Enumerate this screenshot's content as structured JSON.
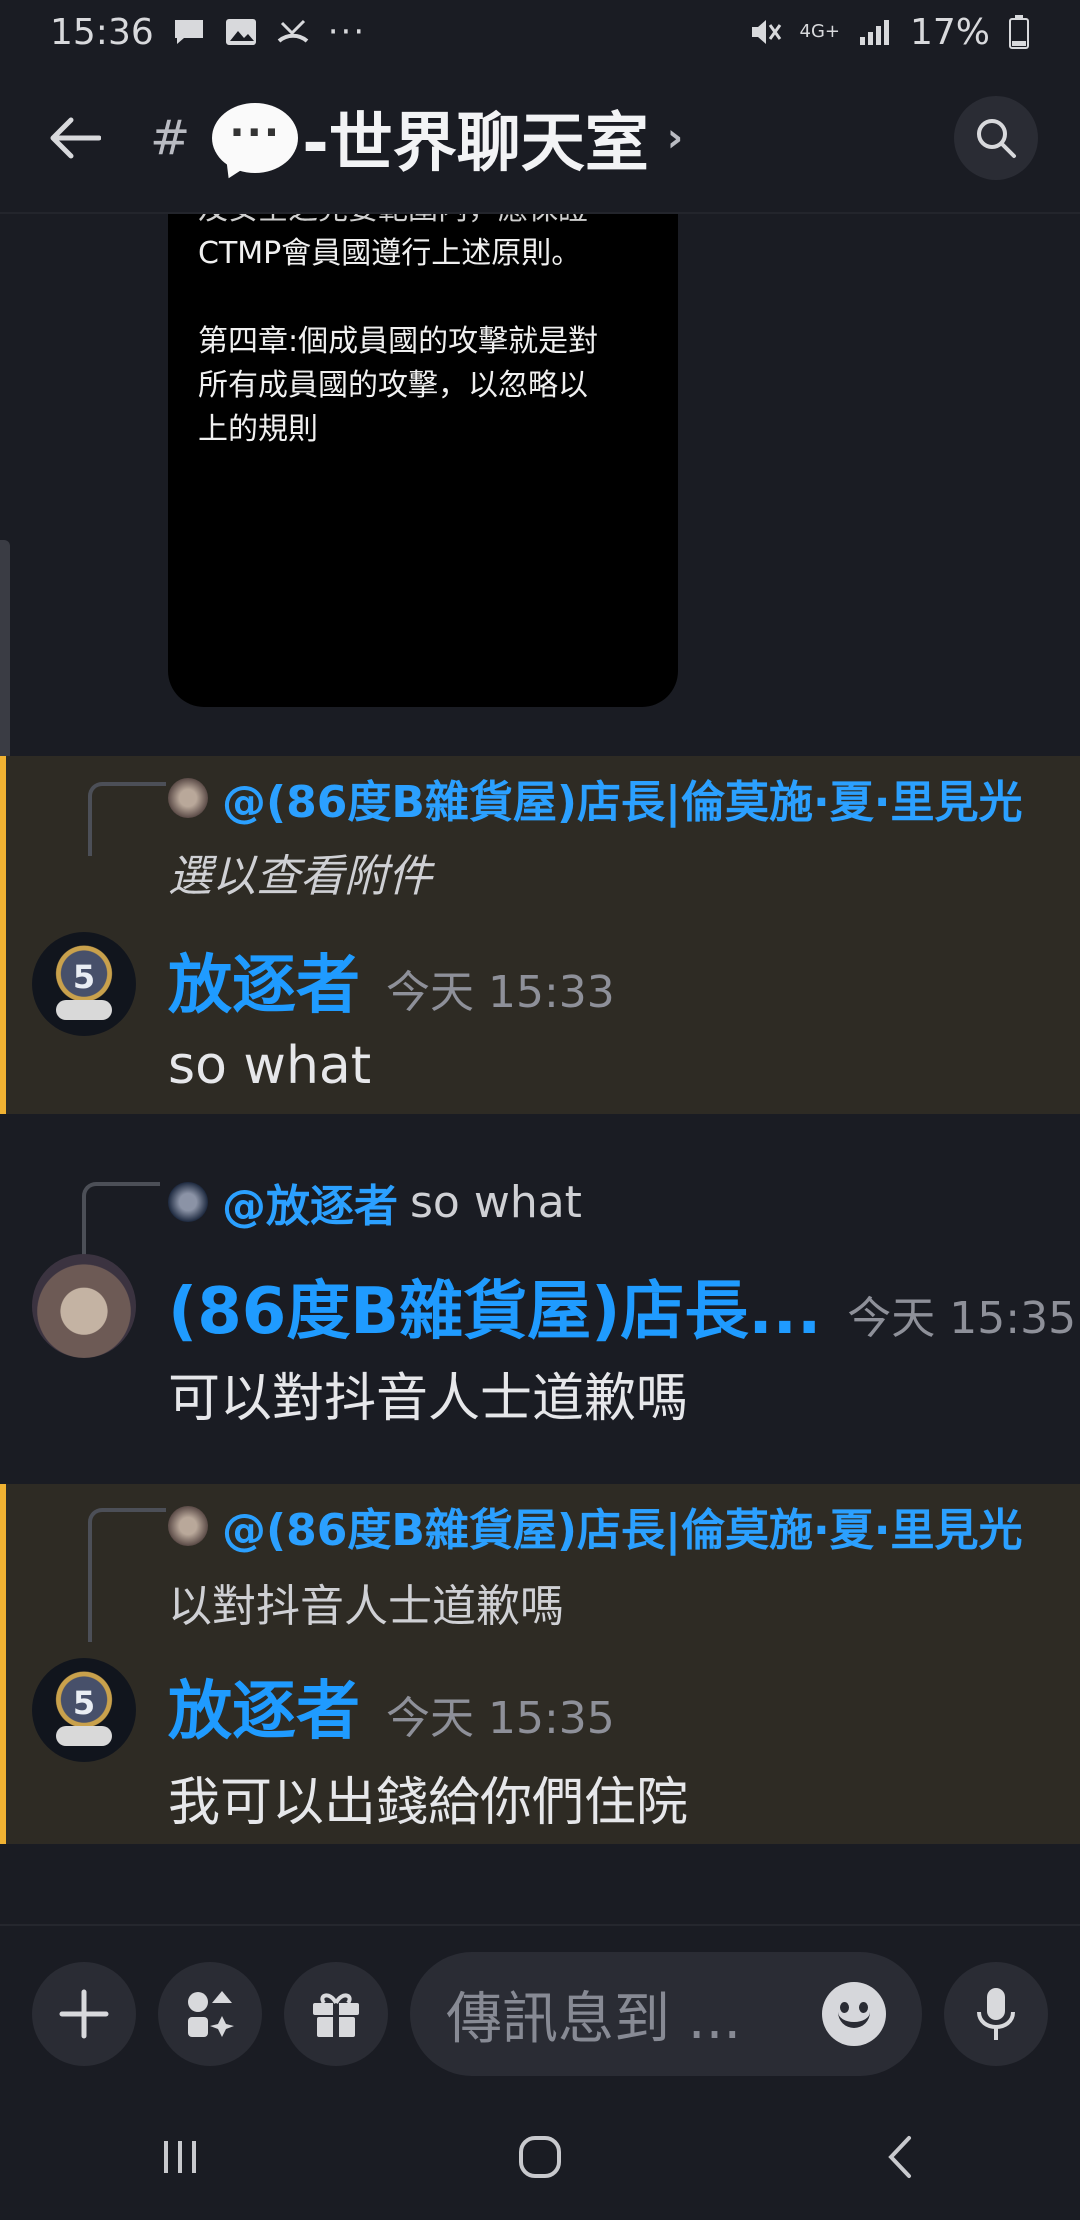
{
  "status_bar": {
    "time": "15:36",
    "network": "4G+",
    "battery": "17%",
    "icons_left": [
      "chat-bubble-icon",
      "image-icon",
      "missed-call-icon",
      "more-dots-icon"
    ],
    "icons_right": [
      "mute-icon",
      "network-icon",
      "signal-icon",
      "battery-icon"
    ]
  },
  "header": {
    "channel_prefix": "#",
    "channel_emoji": "···",
    "channel_name": "-世界聊天室",
    "chevron": "›"
  },
  "image_attachment": {
    "partial_top": "及安全之宪要範圍内，應保證",
    "line1": "CTMP會員國遵行上述原則。",
    "line2": "第四章:個成員國的攻擊就是對\n所有成員國的攻擊，以忽略以\n上的規則"
  },
  "messages": [
    {
      "reply_mention": "@(86度B雜貨屋)店長|倫莫施·夏·里見光",
      "reply_text": "選以查看附件",
      "author": "放逐者",
      "time": "今天 15:33",
      "text": "so what",
      "highlighted": true
    },
    {
      "reply_mention": "@放逐者",
      "reply_text": "so what",
      "author": "(86度B雜貨屋)店長...",
      "time": "今天 15:35",
      "text": "可以對抖音人士道歉嗎",
      "highlighted": false
    },
    {
      "reply_mention": "@(86度B雜貨屋)店長|倫莫施·夏·里見光",
      "reply_text": "以對抖音人士道歉嗎",
      "author": "放逐者",
      "time": "今天 15:35",
      "text": "我可以出錢給你們住院",
      "highlighted": true
    }
  ],
  "composer": {
    "placeholder": "傳訊息到 ...",
    "buttons": [
      "add-icon",
      "apps-icon",
      "gift-icon",
      "emoji-icon",
      "microphone-icon"
    ]
  },
  "colors": {
    "background": "#1a1c23",
    "mention_blue": "#2ba0ff",
    "highlight_bar": "#f0b232",
    "highlight_bg": "#2e2b24"
  }
}
